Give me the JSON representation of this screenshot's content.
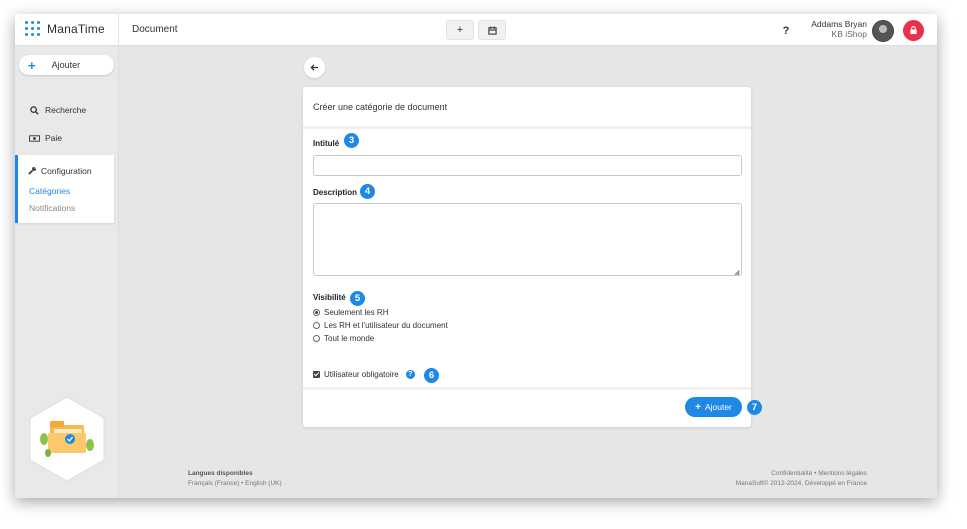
{
  "app": {
    "name": "ManaTime",
    "page_title": "Document"
  },
  "topbar": {
    "add_button_icon": "plus-icon",
    "calendar_button_icon": "calendar-icon",
    "help_label": "?",
    "user_name": "Addams Bryan",
    "user_company": "KB iShop"
  },
  "sidebar": {
    "add_label": "Ajouter",
    "search_label": "Recherche",
    "pay_label": "Paie",
    "config_label": "Configuration",
    "categories_label": "Catégories",
    "notifications_label": "Notifications"
  },
  "form": {
    "title": "Créer une catégorie de document",
    "intitule_label": "Intitulé",
    "intitule_value": "",
    "description_label": "Description",
    "description_value": "",
    "visibility_label": "Visibilité",
    "visibility_options": [
      "Seulement les RH",
      "Les RH et l'utilisateur du document",
      "Tout le monde"
    ],
    "visibility_selected": "Seulement les RH",
    "required_user_label": "Utilisateur obligatoire",
    "required_user_checked": true,
    "submit_label": "Ajouter"
  },
  "badges": {
    "b3": "3",
    "b4": "4",
    "b5": "5",
    "b6": "6",
    "b7": "7"
  },
  "footer": {
    "languages_title": "Langues disponibles",
    "languages": "Français (France) • English (UK)",
    "legal_links": "Confidentialité • Mentions légales",
    "copyright": "ManaSoft© 2012-2024, Développé en France"
  },
  "colors": {
    "accent": "#1e88e5",
    "notification": "#e8304a"
  }
}
